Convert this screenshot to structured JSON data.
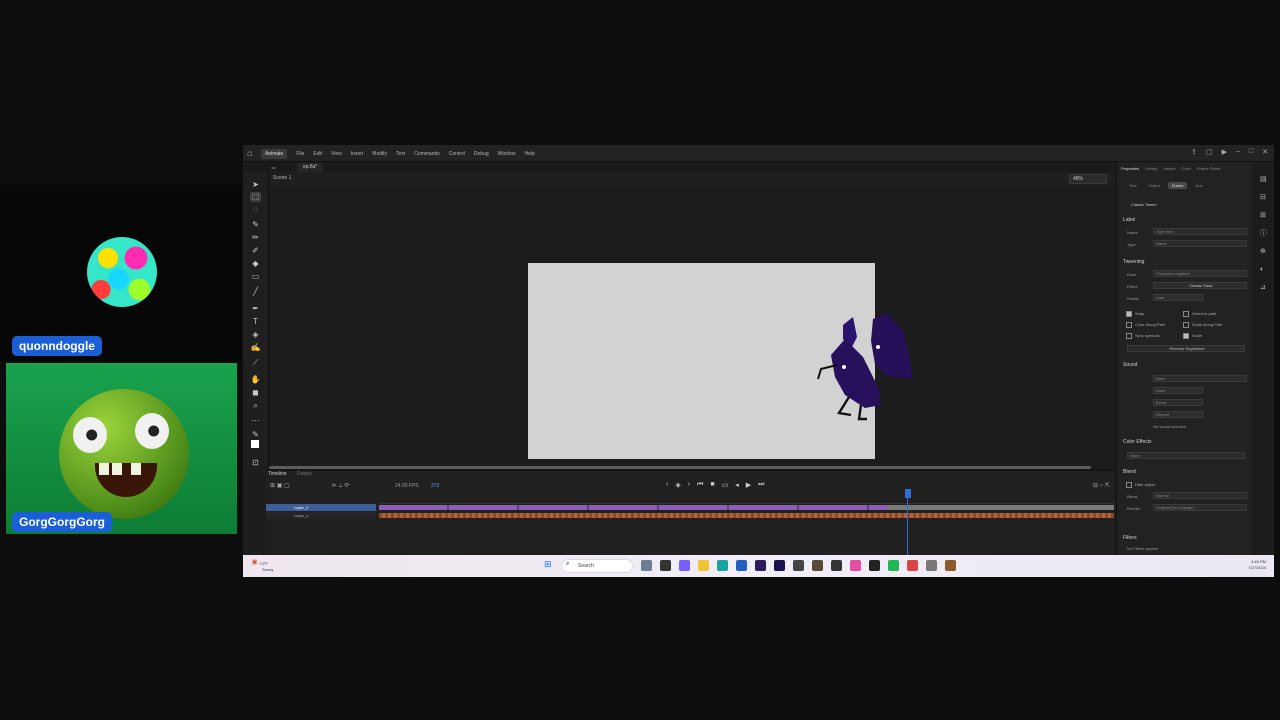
{
  "streamers": [
    {
      "name": "quonndoggle"
    },
    {
      "name": "GorgGorgGorg"
    }
  ],
  "app": {
    "name": "Animate",
    "menus": [
      "File",
      "Edit",
      "View",
      "Insert",
      "Modify",
      "Text",
      "Commands",
      "Control",
      "Debug",
      "Window",
      "Help"
    ],
    "doc_tab": "ep.fla*",
    "scene_label": "Scene 1",
    "zoom": "48%"
  },
  "timeline": {
    "tabs": [
      "Timeline",
      "Output"
    ],
    "fps": "24.00 FPS",
    "frame": "373",
    "layers": [
      {
        "name": "Layer_2"
      },
      {
        "name": "Layer_1"
      }
    ]
  },
  "properties": {
    "tabs": [
      "Properties",
      "Library",
      "Assets",
      "Color",
      "Frame Picker"
    ],
    "subtabs": [
      "Tool",
      "Object",
      "Frame",
      "Doc"
    ],
    "tween_label": "Classic Tween",
    "label_section": "Label",
    "name_label": "Name",
    "name_placeholder": "Type here",
    "type_label": "Type",
    "type_value": "Name",
    "tweening_section": "Tweening",
    "ease_label": "Ease",
    "ease_value": "Properties together",
    "effect_label": "Effect",
    "effect_value": "Classic Ease",
    "rotate_label": "Rotate",
    "rotate_value": "Auto",
    "snap": "Snap",
    "orient": "Orient to path",
    "color_along": "Color Along Path",
    "scale_along": "Scale Along Path",
    "sync": "Sync symbols",
    "scale": "Scale",
    "reverse": "Reverse Keyframes",
    "sound_section": "Sound",
    "sound_name": "None",
    "sound_effect": "None",
    "sound_sync": "Event",
    "sound_repeat": "Repeat",
    "no_sound": "No sound selected",
    "color_effects": "Color Effects",
    "color_value": "None",
    "blend_section": "Blend",
    "hide_object": "Hide object",
    "blend_label": "Blend",
    "blend_value": "Normal",
    "render_label": "Render",
    "render_value": "Original (No Change)",
    "filters": "Filters",
    "no_filters": "No Filters applied"
  },
  "taskbar": {
    "weather_temp": "73°F",
    "weather_desc": "Sunny",
    "search_placeholder": "Search",
    "time": "4:45 PM",
    "date": "7/27/2024"
  },
  "colors": {
    "stage_bg": "#d2d2d2",
    "character_fill": "#26105a",
    "layer_highlight": "#3c5f9c",
    "tween_purple": "#8a5fb5"
  }
}
